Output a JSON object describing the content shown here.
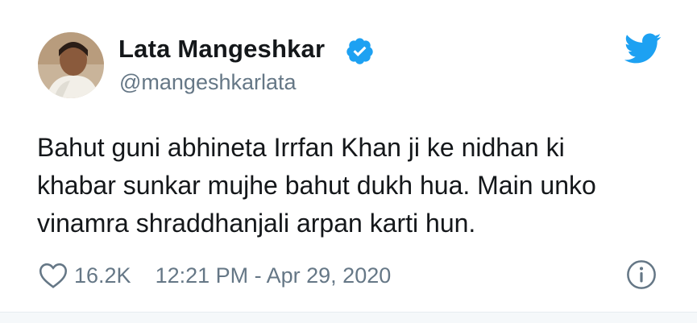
{
  "tweet": {
    "author": {
      "display_name": "Lata Mangeshkar",
      "handle": "@mangeshkarlata",
      "verified": true,
      "avatar_icon": "profile-photo"
    },
    "text_lines": [
      "Bahut guni abhineta Irrfan Khan ji ke nidhan ki",
      "khabar sunkar mujhe bahut dukh hua. Main unko",
      "vinamra shraddhanjali arpan karti hun."
    ],
    "likes": "16.2K",
    "timestamp": "12:21 PM - Apr 29, 2020"
  },
  "icons": {
    "brand": "twitter-bird-icon",
    "verified": "verified-badge-icon",
    "like": "heart-icon",
    "info": "info-icon"
  },
  "colors": {
    "twitter_blue": "#1da1f2",
    "text_primary": "#14171a",
    "text_secondary": "#657786"
  }
}
